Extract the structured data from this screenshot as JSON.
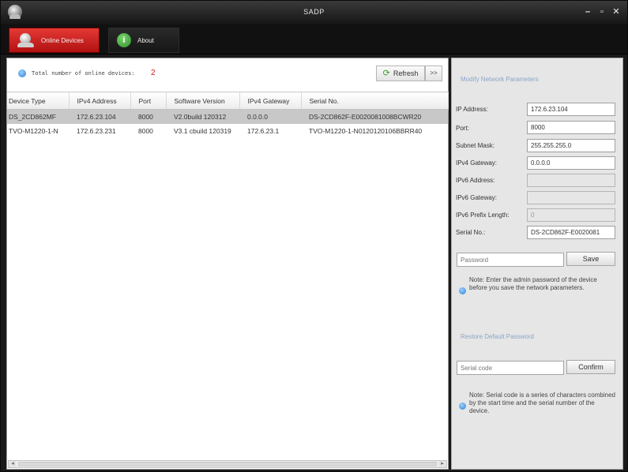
{
  "window": {
    "title": "SADP",
    "controls": [
      "–",
      "▫",
      "✕"
    ]
  },
  "tabs": [
    {
      "label": "Online Devices",
      "active": true
    },
    {
      "label": "About",
      "active": false
    }
  ],
  "device_list": {
    "total_label": "Total number of online devices:",
    "total_count": "2",
    "refresh_label": "Refresh",
    "expand_label": ">>",
    "columns": [
      "Device Type",
      "IPv4 Address",
      "Port",
      "Software Version",
      "IPv4 Gateway",
      "Serial No."
    ],
    "rows": [
      [
        "DS_2CD862MF",
        "172.6.23.104",
        "8000",
        "V2.0build 120312",
        "0.0.0.0",
        "DS-2CD862F-E0020081008BCWR20"
      ],
      [
        "TVO-M1220-1-N",
        "172.6.23.231",
        "8000",
        "V3.1 cbuild 120319",
        "172.6.23.1",
        "TVO-M1220-1-N0120120106BBRR40"
      ]
    ],
    "selected_row": 0
  },
  "network_params": {
    "section_title": "Modify Network Parameters",
    "fields": [
      {
        "label": "IP Address:",
        "value": "172.6.23.104",
        "enabled": true
      },
      {
        "label": "Port:",
        "value": "8000",
        "enabled": true
      },
      {
        "label": "Subnet Mask:",
        "value": "255.255.255.0",
        "enabled": true
      },
      {
        "label": "IPv4 Gateway:",
        "value": "0.0.0.0",
        "enabled": true
      },
      {
        "label": "IPv6 Address:",
        "value": "",
        "enabled": false
      },
      {
        "label": "IPv6 Gateway:",
        "value": "",
        "enabled": false
      },
      {
        "label": "IPv6 Prefix Length:",
        "value": "0",
        "enabled": false
      },
      {
        "label": "Serial No.:",
        "value": "DS-2CD862F-E0020081",
        "enabled": true
      }
    ],
    "password_placeholder": "Password",
    "save_label": "Save",
    "note": "Note: Enter the admin password of the device before you save the network parameters."
  },
  "restore": {
    "section_title": "Restore Default Password",
    "serial_placeholder": "Serial code",
    "confirm_label": "Confirm",
    "note": "Note: Serial code is a series of characters combined by the start time and the serial number of the device."
  },
  "colors": {
    "active_tab": "#d32f2f",
    "section_title": "#8aa6c8",
    "count_red": "#dd1111",
    "selected_row": "#c8c8c8"
  },
  "icons": {
    "app": "camera-dome-icon",
    "online_devices": "camera-dome-icon",
    "about": "info-circle-icon",
    "refresh": "refresh-arrow-icon",
    "note": "info-circle-icon"
  }
}
